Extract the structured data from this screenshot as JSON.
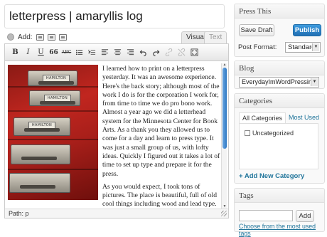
{
  "post": {
    "title": "letterpress | amaryllis log",
    "add_media_label": "Add:",
    "tabs": {
      "visual": "Visual",
      "text": "Text"
    },
    "toolbar": {
      "bold": "B",
      "italic": "I",
      "underline": "U",
      "quote": "66",
      "strike": "ABC"
    },
    "photo_plates": [
      "HAMILTON",
      "HAMILTON",
      "HAMILTON"
    ],
    "paragraphs": [
      "I learned how to print on a letterpress yesterday. It was an awesome experience. Here's the back story; although most of the work I do is for the corporation I work for, from time to time we do pro bono work. Almost a year ago we did a letterhead system for the Minnesota Center for Book Arts. As a thank you they allowed us to come for a day and learn to press type. It was just a small group of us, with lofty ideas. Quickly I figured out it takes a lot of time to set up type and prepare it for the press.",
      "As you would expect, I took tons of pictures. The place is beautiful, full of old cool things including wood and lead type."
    ],
    "path": "Path: p"
  },
  "press_this": {
    "heading": "Press This",
    "save_draft": "Save Draft",
    "publish": "Publish",
    "post_format_label": "Post Format:",
    "post_format_value": "Standard"
  },
  "blog": {
    "heading": "Blog",
    "selected": "EverydayImWordPressing"
  },
  "categories": {
    "heading": "Categories",
    "tab_all": "All Categories",
    "tab_most_used": "Most Used",
    "items": [
      "Uncategorized"
    ],
    "add_new": "+ Add New Category"
  },
  "tags": {
    "heading": "Tags",
    "add_button": "Add",
    "choose_link": "Choose from the most used tags"
  },
  "colors": {
    "link": "#21759b",
    "publish": "#2170b4",
    "photo_red": "#b3231d"
  }
}
